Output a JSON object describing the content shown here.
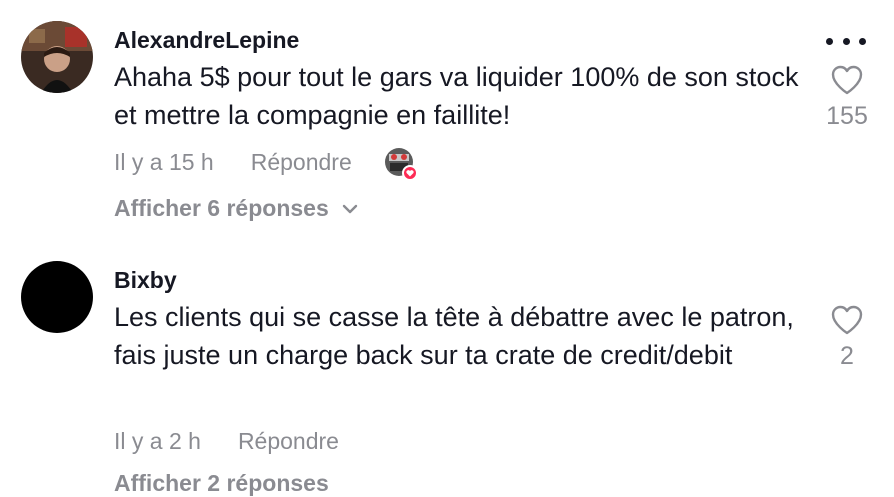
{
  "comments": [
    {
      "username": "AlexandreLepine",
      "text": "Ahaha 5$ pour tout le gars va liquider 100% de son stock et mettre la compagnie en faillite!",
      "time": "Il y a 15 h",
      "reply_label": "Répondre",
      "like_count": "155",
      "view_replies": "Afficher 6 réponses"
    },
    {
      "username": "Bixby",
      "text": "Les clients qui se casse la tête à débattre avec le patron, fais juste un charge back sur ta crate de credit/debit",
      "time": "Il y a 2 h",
      "reply_label": "Répondre",
      "like_count": "2",
      "view_replies": "Afficher 2 réponses"
    }
  ],
  "colors": {
    "text_primary": "#161823",
    "text_secondary": "#8a8b91",
    "like_badge": "#fe2c55"
  }
}
